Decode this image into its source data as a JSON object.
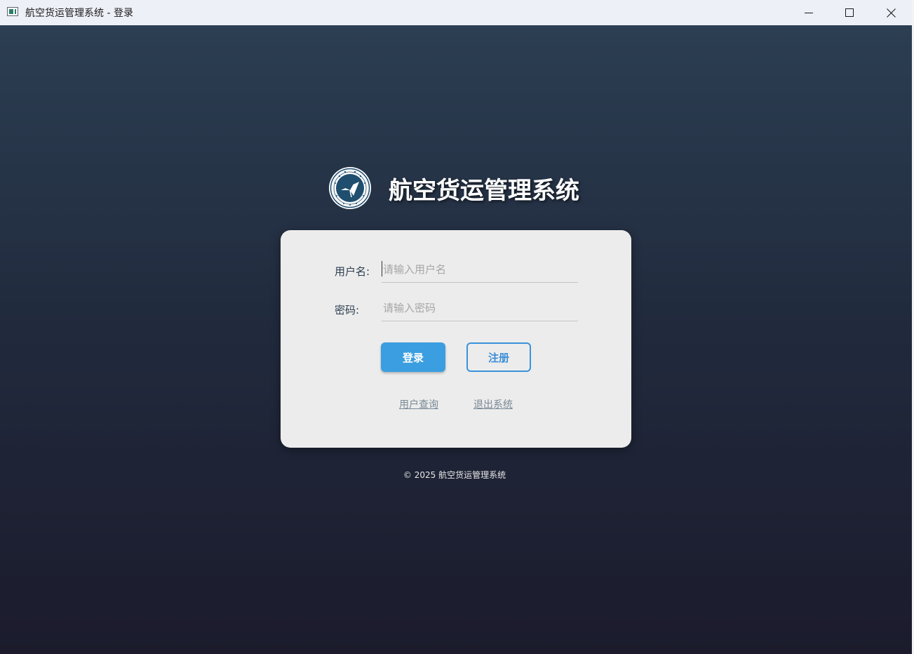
{
  "window": {
    "title": "航空货运管理系统 - 登录",
    "controls": [
      "minimize",
      "maximize",
      "close"
    ]
  },
  "brand": {
    "logo_icon": "university-seal-logo",
    "title": "航空货运管理系统"
  },
  "form": {
    "username_label": "用户名:",
    "username_value": "",
    "username_placeholder": "请输入用户名",
    "password_label": "密码:",
    "password_value": "",
    "password_placeholder": "请输入密码",
    "login_label": "登录",
    "register_label": "注册",
    "query_link": "用户查询",
    "exit_link": "退出系统"
  },
  "footer": {
    "copyright": "© 2025 航空货运管理系统"
  },
  "colors": {
    "bg_top": "#2c3e52",
    "bg_bottom": "#1b1b2c",
    "card": "#ececec",
    "primary": "#3a9ee0",
    "text_dark": "#2c3e50"
  }
}
